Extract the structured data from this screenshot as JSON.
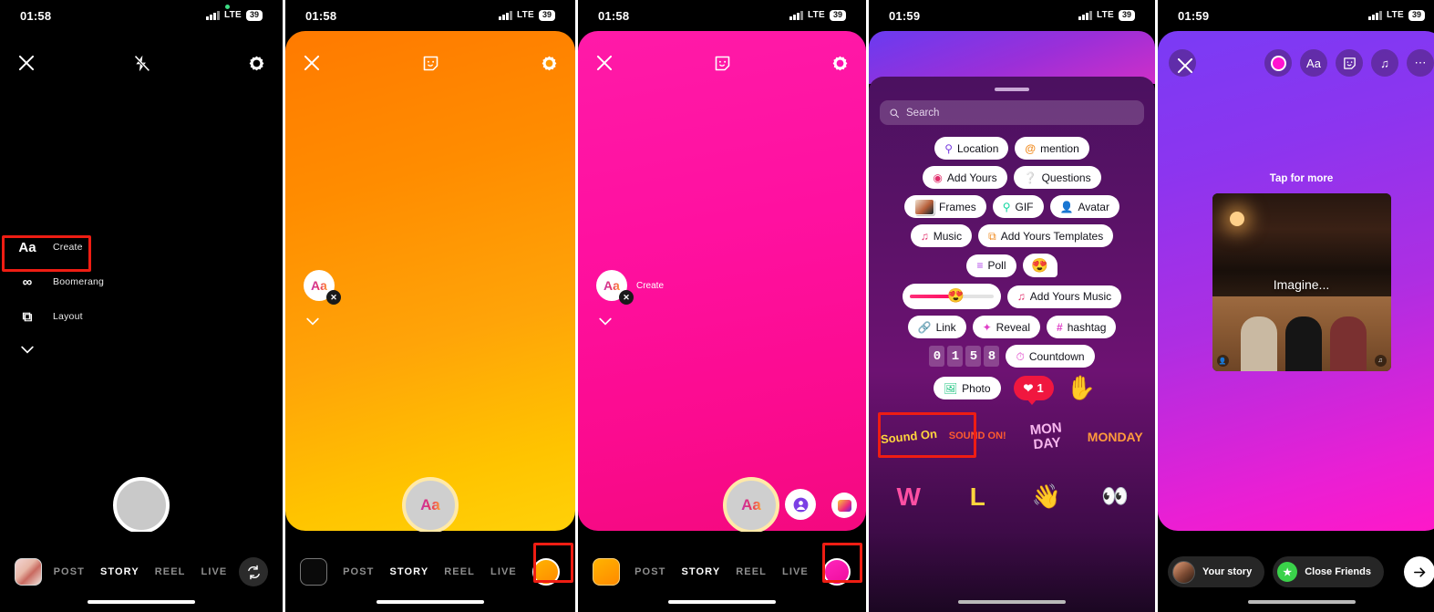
{
  "panels": [
    {
      "id": "camera-create-mode",
      "status": {
        "time": "01:58",
        "network": "LTE",
        "battery": "39"
      },
      "topbar": {
        "close": "close-icon",
        "flash": "flash-off-icon",
        "settings": "gear-icon"
      },
      "modes": [
        {
          "icon": "Aa",
          "label": "Create",
          "highlighted": true
        },
        {
          "icon": "∞",
          "label": "Boomerang",
          "highlighted": false
        },
        {
          "icon": "⧉",
          "label": "Layout",
          "highlighted": false
        }
      ],
      "bottom": {
        "tabs": [
          "POST",
          "STORY",
          "REEL",
          "LIVE"
        ],
        "active_tab": "STORY"
      }
    },
    {
      "id": "create-orange-canvas",
      "status": {
        "time": "01:58",
        "network": "LTE",
        "battery": "39"
      },
      "badge": {
        "label": "Aa",
        "caption": ""
      },
      "shutter_label": "Aa",
      "bottom": {
        "tabs": [
          "POST",
          "STORY",
          "REEL",
          "LIVE"
        ],
        "active_tab": "STORY"
      },
      "color_swatch": "#ff9800"
    },
    {
      "id": "create-magenta-canvas",
      "status": {
        "time": "01:58",
        "network": "LTE",
        "battery": "39"
      },
      "badge": {
        "label": "Aa",
        "caption": "Create"
      },
      "shutter_label": "Aa",
      "bottom": {
        "tabs": [
          "POST",
          "STORY",
          "REEL",
          "LIVE"
        ],
        "active_tab": "STORY"
      },
      "color_swatch": "#ff12b0"
    },
    {
      "id": "sticker-tray",
      "status": {
        "time": "01:59",
        "network": "LTE",
        "battery": "39"
      },
      "search": {
        "placeholder": "Search",
        "value": ""
      },
      "sticker_rows": [
        [
          {
            "icon": "📍",
            "label": "Location"
          },
          {
            "icon": "@",
            "label": "mention"
          }
        ],
        [
          {
            "icon": "◎",
            "label": "Add Yours"
          },
          {
            "icon": "?",
            "label": "Questions"
          }
        ],
        [
          {
            "icon": "img",
            "label": "Frames"
          },
          {
            "icon": "🔍",
            "label": "GIF"
          },
          {
            "icon": "🧑",
            "label": "Avatar"
          }
        ],
        [
          {
            "icon": "♫",
            "label": "Music"
          },
          {
            "icon": "⧉",
            "label": "Add Yours Templates"
          }
        ],
        [
          {
            "icon": "≡",
            "label": "Poll"
          },
          {
            "icon": "😍",
            "label": ""
          }
        ],
        [
          {
            "icon": "slider",
            "label": ""
          },
          {
            "icon": "♫",
            "label": "Add Yours Music"
          }
        ],
        [
          {
            "icon": "🔗",
            "label": "Link"
          },
          {
            "icon": "✦",
            "label": "Reveal"
          },
          {
            "icon": "#",
            "label": "hashtag"
          }
        ],
        [
          {
            "icon": "digits",
            "label": "0158"
          },
          {
            "icon": "◔",
            "label": "Countdown"
          }
        ],
        [
          {
            "icon": "🖼",
            "label": "Photo"
          },
          {
            "icon": "❤",
            "label": "1"
          },
          {
            "icon": "✋",
            "label": ""
          }
        ]
      ],
      "highlighted_chip": "Photo",
      "sticker_grid": [
        [
          "Sound On",
          "SOUND ON!",
          "MON DAY",
          "MONDAY"
        ],
        [
          "W",
          "L",
          "person-waving",
          "eyes"
        ]
      ]
    },
    {
      "id": "story-editor",
      "status": {
        "time": "01:59",
        "network": "LTE",
        "battery": "39"
      },
      "tools": [
        "close-icon",
        "color-picker-icon",
        "Aa",
        "sticker-icon",
        "music-icon",
        "more-icon"
      ],
      "tap_for_more": "Tap for more",
      "photo_caption": "Imagine...",
      "share_options": [
        {
          "label": "Your story",
          "icon": "avatar"
        },
        {
          "label": "Close Friends",
          "icon": "green-star"
        }
      ],
      "send_icon": "arrow-right-icon"
    }
  ],
  "colors": {
    "highlight_box": "#ef1d13",
    "orange": "#ff9800",
    "magenta": "#ff12b0",
    "close_friends_green": "#3ad24a"
  }
}
